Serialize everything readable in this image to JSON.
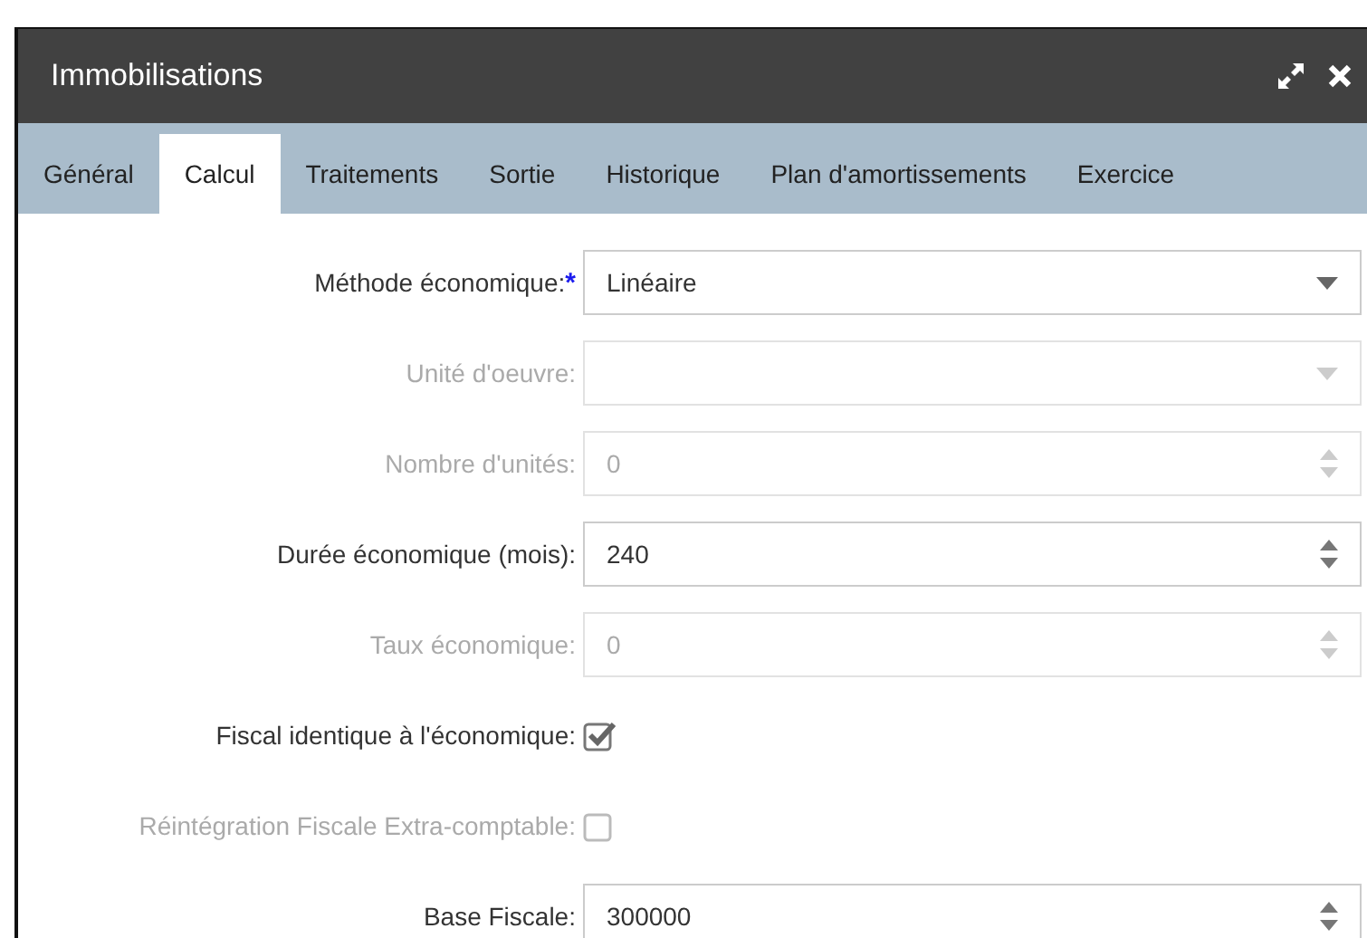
{
  "window": {
    "title": "Immobilisations"
  },
  "tabs": [
    {
      "label": "Général",
      "selected": false
    },
    {
      "label": "Calcul",
      "selected": true
    },
    {
      "label": "Traitements",
      "selected": false
    },
    {
      "label": "Sortie",
      "selected": false
    },
    {
      "label": "Historique",
      "selected": false
    },
    {
      "label": "Plan d'amortissements",
      "selected": false
    },
    {
      "label": "Exercice",
      "selected": false
    }
  ],
  "fields": [
    {
      "kind": "select",
      "label": "Méthode économique:",
      "required_mark": "*",
      "value": "Linéaire",
      "disabled": false
    },
    {
      "kind": "select",
      "label": "Unité d'oeuvre:",
      "disabled": true
    },
    {
      "kind": "number",
      "label": "Nombre d'unités:",
      "value": "0",
      "disabled": true
    },
    {
      "kind": "number",
      "label": "Durée économique (mois):",
      "value": "240",
      "disabled": false
    },
    {
      "kind": "number",
      "label": "Taux économique:",
      "value": "0",
      "disabled": true
    },
    {
      "kind": "checkbox",
      "label": "Fiscal identique à l'économique:",
      "checked": true,
      "disabled": false
    },
    {
      "kind": "checkbox",
      "label": "Réintégration Fiscale Extra-comptable:",
      "checked": false,
      "disabled": true
    },
    {
      "kind": "number",
      "label": "Base Fiscale:",
      "value": "300000",
      "disabled": false
    }
  ]
}
